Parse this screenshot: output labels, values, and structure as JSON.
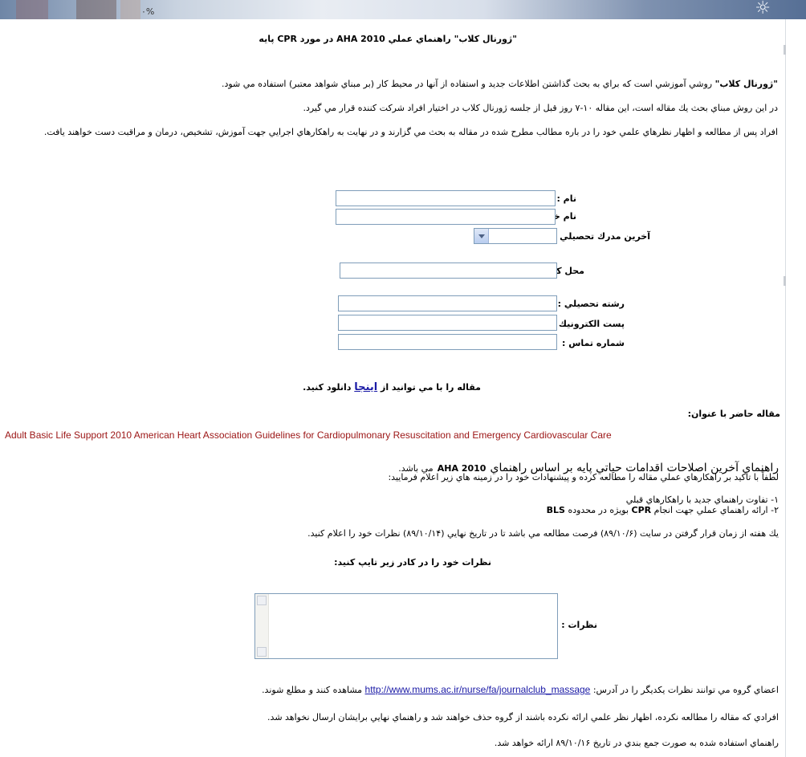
{
  "banner": {
    "percent_text": "۰%"
  },
  "page_title": "\"ژورنال كلاب\" راهنماي عملي AHA 2010 در مورد CPR پايه",
  "intro": {
    "line1_bold": "\"ژورنال كلاب\"",
    "line1_rest": " روشي آموزشي است كه براي به بحث گذاشتن اطلاعات جديد و استفاده از آنها در محيط كار (بر مبناي شواهد معتبر) استفاده مي شود.",
    "line2": "در اين روش مبناي بحث يك مقاله است، اين مقاله ۱۰-۷ روز قبل از جلسه ژورنال كلاب در اختيار افراد شركت كننده قرار مي گيرد.",
    "line3": "افراد پس از مطالعه و اظهار نظرهاي علمي خود را در باره مطالب مطرح شده در مقاله به بحث مي گزارند و در نهايت به راهكارهاي اجرايي جهت آموزش، تشخيص، درمان و مراقبت دست خواهند يافت."
  },
  "form": {
    "name_label": "نام :",
    "family_label": "نام خانوادگي :",
    "degree_label": "آخرين مدرك تحصيلي :",
    "degree_value": "",
    "workplace_label": "محل كار :",
    "field_label": "رشته تحصيلي :",
    "email_label": "پست الكترونيك :",
    "phone_label": "شماره تماس :"
  },
  "download": {
    "before": "مقاله را با مي توانيد از ",
    "link": "اينجا",
    "after": " دانلود كنيد."
  },
  "article": {
    "heading": "مقاله حاضر با عنوان:",
    "english_title": "Adult Basic Life Support 2010 American Heart Association Guidelines for Cardiopulmonary Resuscitation and Emergency Cardiovascular Care",
    "desc_big": "راهنماي آخرين اصلاحات اقدامات حياتي پايه بر اساس راهنماي",
    "desc_bold": "AHA 2010",
    "desc_small": "مي باشد.",
    "request": "لطفاً با تاكيد بر راهكارهاي عملي مقاله را مطالعه كرده و پيشنهادات خود را در زمينه هاي زير اعلام فرماييد:",
    "item1": "۱- تفاوت راهنماي جديد با راهكارهاي قبلي",
    "item2_pre": "۲- ارائه راهنماي عملي جهت انجام ",
    "item2_cpr": "CPR",
    "item2_mid": " بويژه در محدوده ",
    "item2_bls": "BLS",
    "deadline": "يك هفته از زمان قرار گرفتن در سايت (۸۹/۱۰/۶) فرصت مطالعه مي باشد تا در تاريخ نهايي (۸۹/۱۰/۱۴) نظرات خود را اعلام كنيد."
  },
  "comments": {
    "heading": "نظرات خود را در كادر زير تايپ كنيد:",
    "label": "نظرات :",
    "value": ""
  },
  "footer": {
    "members_pre": "اعضاي گروه مي توانند نظرات يكديگر را در آدرس: ",
    "members_link": "http://www.mums.ac.ir/nurse/fa/journalclub_massage",
    "members_post": " مشاهده كنند و مطلع شوند.",
    "warning": "افرادي كه مقاله را مطالعه نكرده، اظهار نظر علمي ارائه نكرده باشند از گروه حذف خواهند شد و راهنماي نهايي برايشان ارسال نخواهد شد.",
    "final": "راهنماي استفاده شده به صورت جمع بندي در تاريخ ۸۹/۱۰/۱۶ ارائه خواهد شد."
  }
}
